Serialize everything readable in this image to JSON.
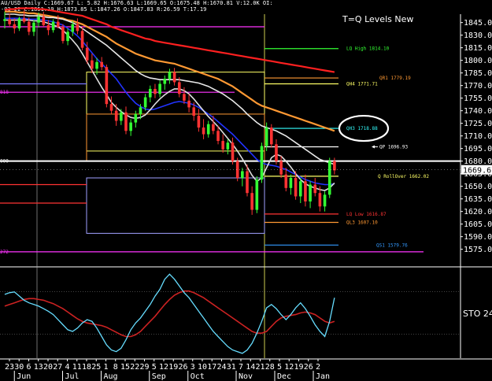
{
  "chart_data": {
    "type": "candlestick",
    "header": "-03-22 C:1851.19 H:1873.85 L:1847.26 O:1847.83 R:26.59 T:17.19",
    "header2": "AU/USD Daily C:1669.67 L: 5.82 H:1676.63 L:1669.65 O:1675.48 H:1670.81 V:12.0K OI:",
    "title": "T=Q Levels New",
    "ylim": [
      1555,
      1855
    ],
    "y_ticks": [
      1845,
      1830,
      1815,
      1800,
      1785,
      1770,
      1755,
      1740,
      1725,
      1710,
      1695,
      1680,
      1665,
      1650,
      1635,
      1620,
      1605,
      1590,
      1575
    ],
    "y_tick_labels": [
      "1845.00",
      "1830.00",
      "1815.00",
      "1800.00",
      "1785.00",
      "1770.00",
      "1755.00",
      "1740.00",
      "1725.00",
      "1710.00",
      "1695.00",
      "1680.00",
      "1665.00",
      "1650.00",
      "1635.00",
      "1620.00",
      "1605.00",
      "1590.00",
      "1575.00"
    ],
    "current_price": "1669.67",
    "current_price_value": 1669.67,
    "left_stub_labels": [
      {
        "text": "818",
        "value": 1762,
        "color": "#ff33ff"
      },
      {
        "text": "000",
        "value": 1680,
        "color": "#ffffff"
      },
      {
        "text": "272",
        "value": 1572,
        "color": "#ff33ff"
      }
    ],
    "x_ticks": [
      "23",
      "30",
      "6",
      "13",
      "20",
      "27",
      "4",
      "11",
      "18",
      "25",
      "1",
      "8",
      "15",
      "22",
      "29",
      "5",
      "12",
      "19",
      "26",
      "3",
      "10",
      "17",
      "24",
      "31",
      "7",
      "14",
      "21",
      "28",
      "5",
      "12",
      "19",
      "26",
      "2"
    ],
    "months": [
      "Jun",
      "Jul",
      "Aug",
      "Sep",
      "Oct",
      "Nov",
      "Dec",
      "Jan"
    ],
    "month_tick_index": [
      1,
      6,
      10,
      15,
      19,
      24,
      28,
      32
    ],
    "levels": [
      {
        "label": "LQ High 1814.10",
        "value": 1814,
        "color": "#33ff33",
        "start": 65,
        "end": 86
      },
      {
        "label": "QR1 1779.19",
        "value": 1779,
        "color": "#ff9933",
        "start": 65,
        "end": 86
      },
      {
        "label": "QH4 1771.71",
        "value": 1772,
        "color": "#ffff66",
        "start": 65,
        "end": 86
      },
      {
        "label": "QH3 1718.88",
        "value": 1719,
        "color": "#33ffff",
        "start": 65,
        "end": 86
      },
      {
        "label": "QP 1696.93",
        "value": 1697,
        "color": "#ffffff",
        "start": 65,
        "end": 86
      },
      {
        "label": "Q RollOver 1662.02",
        "value": 1662,
        "color": "#ffff66",
        "start": 65,
        "end": 86
      },
      {
        "label": "LQ Low 1616.87",
        "value": 1617,
        "color": "#ff3333",
        "start": 65,
        "end": 86
      },
      {
        "label": "QL3 1607.10",
        "value": 1607,
        "color": "#ff9933",
        "start": 65,
        "end": 86
      },
      {
        "label": "QS1 1579.76",
        "value": 1580,
        "color": "#3399ff",
        "start": 65,
        "end": 86
      }
    ],
    "bars": [
      [
        1847,
        1858,
        1838,
        1849
      ],
      [
        1849,
        1856,
        1840,
        1843
      ],
      [
        1843,
        1850,
        1832,
        1838
      ],
      [
        1838,
        1852,
        1835,
        1850
      ],
      [
        1850,
        1860,
        1844,
        1846
      ],
      [
        1846,
        1851,
        1830,
        1834
      ],
      [
        1834,
        1848,
        1829,
        1845
      ],
      [
        1845,
        1857,
        1839,
        1852
      ],
      [
        1852,
        1858,
        1840,
        1842
      ],
      [
        1842,
        1848,
        1830,
        1836
      ],
      [
        1836,
        1849,
        1833,
        1846
      ],
      [
        1846,
        1854,
        1838,
        1840
      ],
      [
        1840,
        1843,
        1820,
        1823
      ],
      [
        1823,
        1838,
        1818,
        1834
      ],
      [
        1834,
        1847,
        1829,
        1843
      ],
      [
        1843,
        1850,
        1831,
        1835
      ],
      [
        1835,
        1840,
        1812,
        1815
      ],
      [
        1815,
        1822,
        1796,
        1800
      ],
      [
        1800,
        1808,
        1785,
        1790
      ],
      [
        1790,
        1803,
        1783,
        1798
      ],
      [
        1798,
        1804,
        1788,
        1792
      ],
      [
        1792,
        1795,
        1744,
        1748
      ],
      [
        1748,
        1757,
        1736,
        1740
      ],
      [
        1740,
        1748,
        1722,
        1728
      ],
      [
        1728,
        1742,
        1723,
        1738
      ],
      [
        1738,
        1745,
        1712,
        1716
      ],
      [
        1716,
        1730,
        1710,
        1726
      ],
      [
        1726,
        1740,
        1720,
        1736
      ],
      [
        1736,
        1748,
        1730,
        1744
      ],
      [
        1744,
        1760,
        1740,
        1756
      ],
      [
        1756,
        1770,
        1750,
        1766
      ],
      [
        1766,
        1772,
        1755,
        1760
      ],
      [
        1760,
        1776,
        1756,
        1772
      ],
      [
        1772,
        1782,
        1765,
        1778
      ],
      [
        1778,
        1790,
        1772,
        1786
      ],
      [
        1786,
        1791,
        1770,
        1774
      ],
      [
        1774,
        1780,
        1756,
        1760
      ],
      [
        1760,
        1768,
        1748,
        1752
      ],
      [
        1752,
        1760,
        1738,
        1744
      ],
      [
        1744,
        1750,
        1728,
        1734
      ],
      [
        1734,
        1742,
        1715,
        1720
      ],
      [
        1720,
        1730,
        1706,
        1712
      ],
      [
        1712,
        1728,
        1708,
        1724
      ],
      [
        1724,
        1734,
        1712,
        1716
      ],
      [
        1716,
        1722,
        1700,
        1704
      ],
      [
        1704,
        1712,
        1690,
        1694
      ],
      [
        1694,
        1706,
        1688,
        1702
      ],
      [
        1702,
        1708,
        1676,
        1680
      ],
      [
        1680,
        1684,
        1656,
        1660
      ],
      [
        1660,
        1672,
        1650,
        1668
      ],
      [
        1668,
        1676,
        1638,
        1642
      ],
      [
        1642,
        1650,
        1616,
        1622
      ],
      [
        1622,
        1662,
        1618,
        1658
      ],
      [
        1658,
        1702,
        1654,
        1698
      ],
      [
        1698,
        1726,
        1692,
        1720
      ],
      [
        1720,
        1724,
        1696,
        1700
      ],
      [
        1700,
        1706,
        1676,
        1680
      ],
      [
        1680,
        1686,
        1660,
        1664
      ],
      [
        1664,
        1672,
        1644,
        1648
      ],
      [
        1648,
        1664,
        1640,
        1660
      ],
      [
        1660,
        1668,
        1634,
        1638
      ],
      [
        1638,
        1660,
        1630,
        1656
      ],
      [
        1656,
        1664,
        1626,
        1632
      ],
      [
        1632,
        1656,
        1624,
        1652
      ],
      [
        1652,
        1660,
        1638,
        1642
      ],
      [
        1642,
        1650,
        1620,
        1626
      ],
      [
        1626,
        1644,
        1620,
        1640
      ],
      [
        1640,
        1684,
        1636,
        1680
      ],
      [
        1680,
        1684,
        1664,
        1669
      ]
    ],
    "ma_series": [
      {
        "color": "#ff2020",
        "values": [
          1860,
          1861,
          1861,
          1862,
          1862,
          1862,
          1862,
          1861,
          1861,
          1860,
          1859,
          1858,
          1857,
          1856,
          1855,
          1854,
          1853,
          1851,
          1849,
          1847,
          1845,
          1843,
          1840,
          1838,
          1836,
          1834,
          1832,
          1830,
          1828,
          1826,
          1825,
          1823,
          1822,
          1821,
          1820,
          1819,
          1818,
          1817,
          1816,
          1815,
          1814,
          1813,
          1812,
          1811,
          1810,
          1809,
          1808,
          1807,
          1806,
          1805,
          1804,
          1803,
          1802,
          1801,
          1800,
          1799,
          1798,
          1797,
          1796,
          1795,
          1794,
          1793,
          1792,
          1791,
          1790,
          1789,
          1788,
          1787,
          1786
        ]
      },
      {
        "color": "#ff9933",
        "values": [
          1858,
          1858,
          1858,
          1857,
          1857,
          1856,
          1856,
          1855,
          1854,
          1853,
          1852,
          1851,
          1850,
          1848,
          1847,
          1845,
          1843,
          1840,
          1837,
          1834,
          1831,
          1828,
          1824,
          1820,
          1817,
          1814,
          1811,
          1808,
          1806,
          1804,
          1802,
          1800,
          1799,
          1798,
          1797,
          1796,
          1794,
          1792,
          1790,
          1788,
          1786,
          1784,
          1782,
          1780,
          1778,
          1775,
          1772,
          1769,
          1765,
          1761,
          1757,
          1753,
          1749,
          1746,
          1744,
          1742,
          1740,
          1738,
          1736,
          1734,
          1732,
          1730,
          1728,
          1726,
          1724,
          1722,
          1720,
          1718,
          1716
        ]
      },
      {
        "color": "#e8e8e8",
        "values": [
          1855,
          1855,
          1855,
          1854,
          1854,
          1853,
          1853,
          1853,
          1852,
          1851,
          1851,
          1850,
          1849,
          1847,
          1845,
          1842,
          1838,
          1834,
          1830,
          1826,
          1822,
          1818,
          1813,
          1808,
          1803,
          1798,
          1793,
          1788,
          1784,
          1781,
          1779,
          1778,
          1777,
          1777,
          1777,
          1777,
          1777,
          1776,
          1775,
          1774,
          1773,
          1771,
          1769,
          1766,
          1763,
          1760,
          1756,
          1752,
          1747,
          1742,
          1736,
          1731,
          1726,
          1722,
          1720,
          1718,
          1716,
          1713,
          1710,
          1706,
          1702,
          1698,
          1694,
          1690,
          1686,
          1682,
          1680,
          1678,
          1676
        ]
      },
      {
        "color": "#2233ff",
        "values": [
          1850,
          1850,
          1850,
          1850,
          1850,
          1849,
          1849,
          1849,
          1848,
          1847,
          1846,
          1844,
          1842,
          1838,
          1834,
          1829,
          1823,
          1816,
          1809,
          1802,
          1796,
          1790,
          1784,
          1778,
          1770,
          1762,
          1755,
          1749,
          1745,
          1742,
          1741,
          1742,
          1744,
          1746,
          1748,
          1750,
          1751,
          1750,
          1749,
          1747,
          1744,
          1740,
          1736,
          1732,
          1727,
          1722,
          1717,
          1712,
          1706,
          1700,
          1694,
          1688,
          1682,
          1678,
          1676,
          1675,
          1674,
          1672,
          1670,
          1667,
          1664,
          1661,
          1658,
          1656,
          1654,
          1653,
          1652,
          1652,
          1653
        ]
      },
      {
        "color": "#dddddd",
        "values": [
          1848,
          1848,
          1848,
          1848,
          1848,
          1848,
          1847,
          1847,
          1846,
          1844,
          1842,
          1840,
          1836,
          1830,
          1824,
          1817,
          1808,
          1798,
          1788,
          1778,
          1768,
          1759,
          1750,
          1744,
          1739,
          1735,
          1732,
          1731,
          1732,
          1735,
          1741,
          1748,
          1754,
          1759,
          1763,
          1766,
          1766,
          1764,
          1760,
          1754,
          1747,
          1740,
          1733,
          1727,
          1721,
          1714,
          1707,
          1700,
          1692,
          1683,
          1673,
          1663,
          1656,
          1660,
          1672,
          1684,
          1688,
          1686,
          1680,
          1673,
          1665,
          1658,
          1653,
          1650,
          1648,
          1646,
          1645,
          1648,
          1654
        ]
      }
    ],
    "stoch": {
      "label": "STO 24",
      "ylim": [
        0,
        100
      ],
      "k": [
        72,
        74,
        75,
        70,
        65,
        62,
        60,
        58,
        55,
        52,
        48,
        42,
        36,
        30,
        28,
        32,
        38,
        42,
        40,
        32,
        22,
        12,
        6,
        4,
        8,
        18,
        30,
        38,
        44,
        52,
        60,
        70,
        78,
        90,
        96,
        90,
        82,
        74,
        68,
        60,
        52,
        44,
        36,
        28,
        22,
        16,
        10,
        6,
        4,
        2,
        6,
        14,
        26,
        40,
        56,
        60,
        55,
        48,
        42,
        48,
        56,
        62,
        55,
        46,
        36,
        28,
        22,
        40,
        68
      ],
      "d": [
        58,
        60,
        62,
        64,
        66,
        67,
        67,
        66,
        65,
        63,
        61,
        58,
        55,
        51,
        47,
        43,
        40,
        38,
        37,
        36,
        35,
        33,
        30,
        27,
        24,
        22,
        22,
        24,
        28,
        34,
        40,
        46,
        53,
        60,
        66,
        71,
        74,
        76,
        76,
        74,
        71,
        68,
        64,
        60,
        56,
        52,
        48,
        44,
        40,
        36,
        32,
        28,
        26,
        26,
        28,
        34,
        40,
        44,
        46,
        47,
        48,
        50,
        51,
        50,
        48,
        44,
        40,
        38,
        40
      ]
    }
  }
}
